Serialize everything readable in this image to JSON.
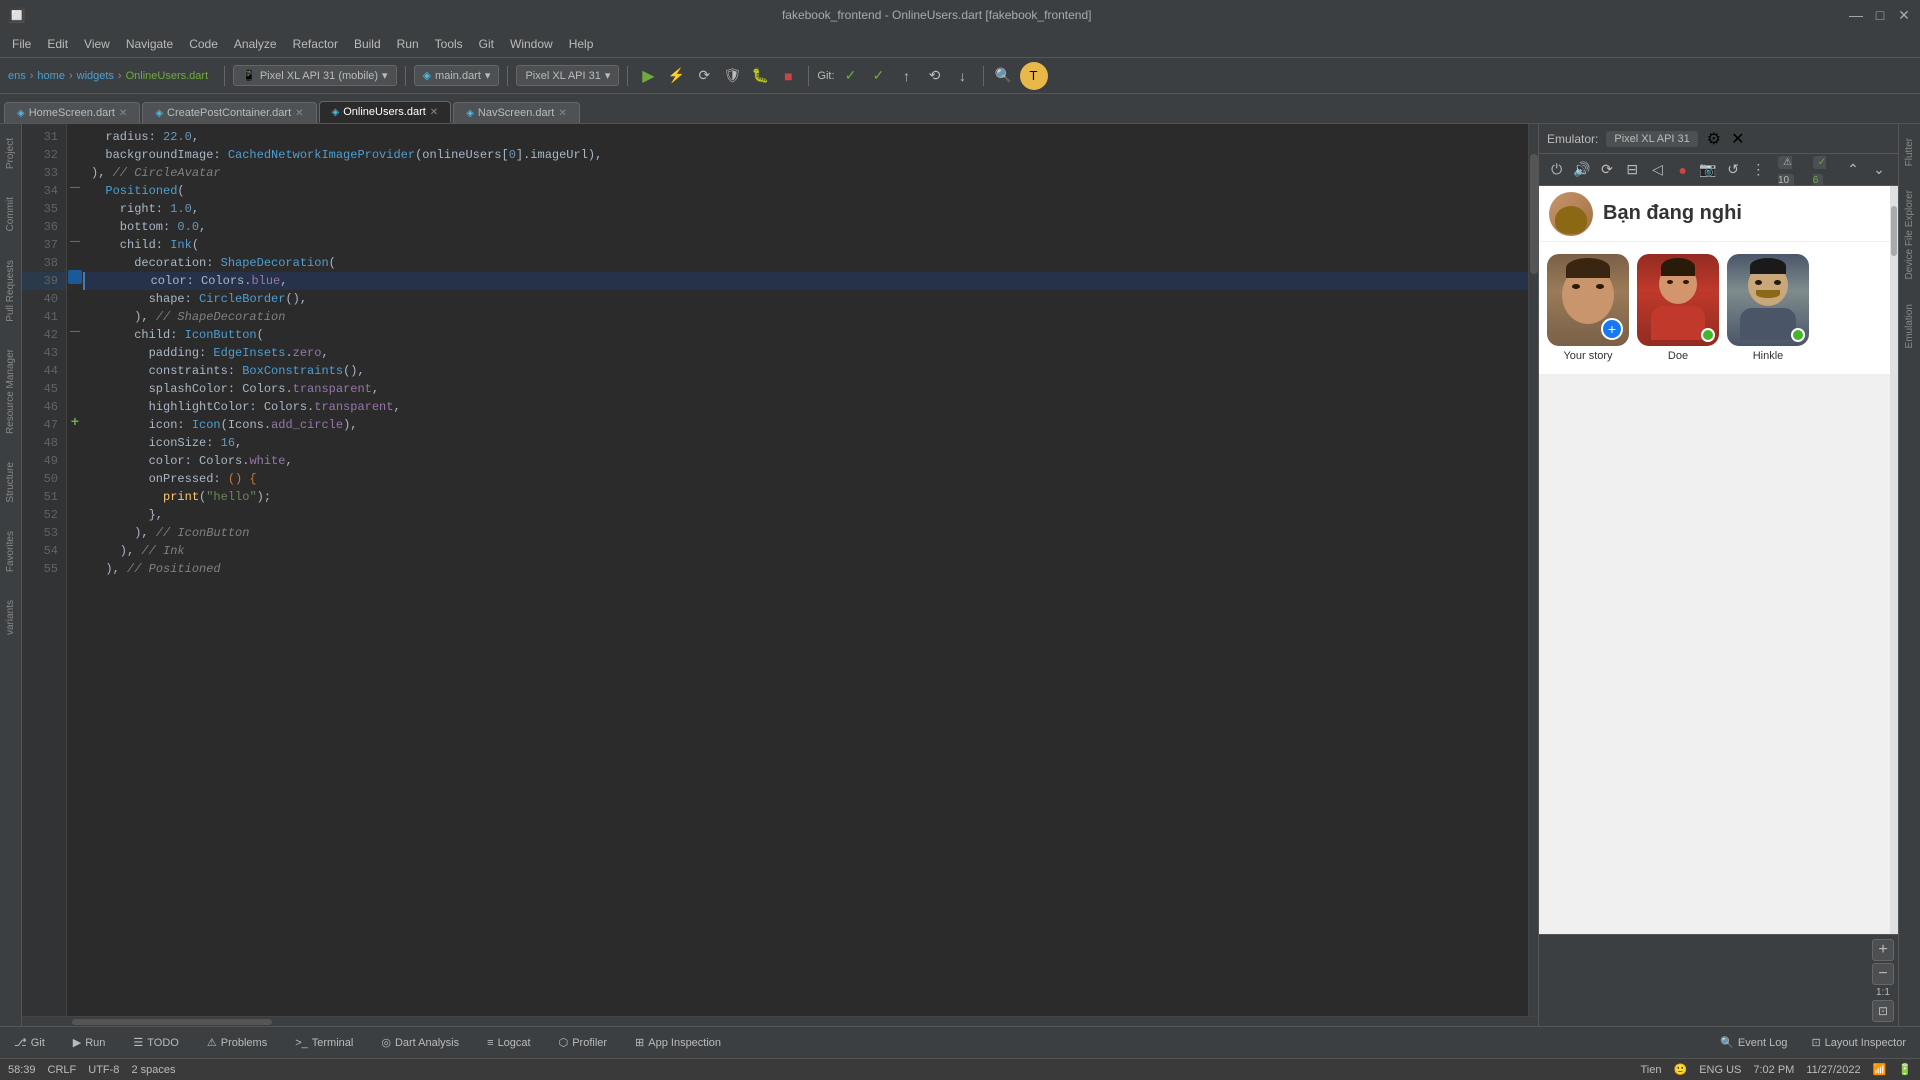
{
  "titleBar": {
    "title": "fakebook_frontend - OnlineUsers.dart [fakebook_frontend]",
    "minimize": "—",
    "maximize": "□",
    "close": "✕"
  },
  "menuBar": {
    "items": [
      "🔲",
      "File",
      "Edit",
      "View",
      "Navigate",
      "Code",
      "Analyze",
      "Refactor",
      "Build",
      "Run",
      "Tools",
      "Git",
      "Window",
      "Help"
    ]
  },
  "toolbar": {
    "breadcrumb": [
      "ens",
      "home",
      "widgets",
      "OnlineUsers.dart"
    ],
    "device": "Pixel XL API 31 (mobile)",
    "mainDart": "main.dart",
    "pixelXL": "Pixel XL API 31",
    "gitBadge": "Git:"
  },
  "tabs": [
    {
      "label": "HomeScreen.dart",
      "active": false
    },
    {
      "label": "CreatePostContainer.dart",
      "active": false
    },
    {
      "label": "OnlineUsers.dart",
      "active": true
    },
    {
      "label": "NavScreen.dart",
      "active": false
    }
  ],
  "code": {
    "lines": [
      {
        "num": 31,
        "content": "  radius: 22.0,",
        "tokens": [
          {
            "text": "  radius: ",
            "cls": ""
          },
          {
            "text": "22.0",
            "cls": "num"
          },
          {
            "text": ",",
            "cls": ""
          }
        ]
      },
      {
        "num": 32,
        "content": "  backgroundImage: CachedNetworkImageProvider(onlineUsers[0].imageUrl),",
        "tokens": [
          {
            "text": "  backgroundImage: ",
            "cls": ""
          },
          {
            "text": "CachedNetworkImageProvider",
            "cls": "blue-kw"
          },
          {
            "text": "(onlineUsers[",
            "cls": ""
          },
          {
            "text": "0",
            "cls": "num"
          },
          {
            "text": "].imageUrl),",
            "cls": ""
          }
        ]
      },
      {
        "num": 33,
        "content": "), // CircleAvatar",
        "tokens": [
          {
            "text": "), ",
            "cls": ""
          },
          {
            "text": "// CircleAvatar",
            "cls": "cmt"
          }
        ]
      },
      {
        "num": 34,
        "content": "  Positioned(",
        "tokens": [
          {
            "text": "  "
          },
          {
            "text": "Positioned",
            "cls": "blue-kw"
          },
          {
            "text": "(",
            "cls": ""
          }
        ],
        "hasArrow": true
      },
      {
        "num": 35,
        "content": "  right: 1.0,",
        "tokens": [
          {
            "text": "    right: ",
            "cls": ""
          },
          {
            "text": "1.0",
            "cls": "num"
          },
          {
            "text": ",",
            "cls": ""
          }
        ]
      },
      {
        "num": 36,
        "content": "  bottom: 0.0,",
        "tokens": [
          {
            "text": "    bottom: ",
            "cls": ""
          },
          {
            "text": "0.0",
            "cls": "num"
          },
          {
            "text": ",",
            "cls": ""
          }
        ]
      },
      {
        "num": 37,
        "content": "  child: Ink(",
        "tokens": [
          {
            "text": "    child: ",
            "cls": ""
          },
          {
            "text": "Ink",
            "cls": "blue-kw"
          },
          {
            "text": "(",
            "cls": ""
          }
        ],
        "hasArrow": true
      },
      {
        "num": 38,
        "content": "    decoration: ShapeDecoration(",
        "tokens": [
          {
            "text": "      decoration: ",
            "cls": ""
          },
          {
            "text": "ShapeDecoration",
            "cls": "blue-kw"
          },
          {
            "text": "(",
            "cls": ""
          }
        ]
      },
      {
        "num": 39,
        "content": "      color: Colors.blue,",
        "tokens": [
          {
            "text": "        color: ",
            "cls": ""
          },
          {
            "text": "Colors",
            "cls": "var"
          },
          {
            "text": ".",
            "cls": ""
          },
          {
            "text": "blue",
            "cls": "prop"
          },
          {
            "text": ",",
            "cls": ""
          }
        ],
        "highlighted": true,
        "hasMarker": true
      },
      {
        "num": 40,
        "content": "      shape: CircleBorder(),",
        "tokens": [
          {
            "text": "        shape: ",
            "cls": ""
          },
          {
            "text": "CircleBorder",
            "cls": "blue-kw"
          },
          {
            "text": "(),",
            "cls": ""
          }
        ]
      },
      {
        "num": 41,
        "content": "    ), // ShapeDecoration",
        "tokens": [
          {
            "text": "      ), ",
            "cls": ""
          },
          {
            "text": "// ShapeDecoration",
            "cls": "cmt"
          }
        ]
      },
      {
        "num": 42,
        "content": "    child: IconButton(",
        "tokens": [
          {
            "text": "      child: ",
            "cls": ""
          },
          {
            "text": "IconButton",
            "cls": "blue-kw"
          },
          {
            "text": "(",
            "cls": ""
          }
        ],
        "hasArrow": true
      },
      {
        "num": 43,
        "content": "      padding: EdgeInsets.zero,",
        "tokens": [
          {
            "text": "        padding: ",
            "cls": ""
          },
          {
            "text": "EdgeInsets",
            "cls": "blue-kw"
          },
          {
            "text": ".",
            "cls": ""
          },
          {
            "text": "zero",
            "cls": "prop"
          },
          {
            "text": ",",
            "cls": ""
          }
        ]
      },
      {
        "num": 44,
        "content": "      constraints: BoxConstraints(),",
        "tokens": [
          {
            "text": "        constraints: ",
            "cls": ""
          },
          {
            "text": "BoxConstraints",
            "cls": "blue-kw"
          },
          {
            "text": "(),",
            "cls": ""
          }
        ]
      },
      {
        "num": 45,
        "content": "      splashColor: Colors.transparent,",
        "tokens": [
          {
            "text": "        splashColor: ",
            "cls": ""
          },
          {
            "text": "Colors",
            "cls": "var"
          },
          {
            "text": ".",
            "cls": ""
          },
          {
            "text": "transparent",
            "cls": "prop"
          },
          {
            "text": ",",
            "cls": ""
          }
        ]
      },
      {
        "num": 46,
        "content": "      highlightColor: Colors.transparent,",
        "tokens": [
          {
            "text": "        highlightColor: ",
            "cls": ""
          },
          {
            "text": "Colors",
            "cls": "var"
          },
          {
            "text": ".",
            "cls": ""
          },
          {
            "text": "transparent",
            "cls": "prop"
          },
          {
            "text": ",",
            "cls": ""
          }
        ]
      },
      {
        "num": 47,
        "content": "    icon: Icon(Icons.add_circle),",
        "tokens": [
          {
            "text": "        icon: ",
            "cls": ""
          },
          {
            "text": "Icon",
            "cls": "blue-kw"
          },
          {
            "text": "(",
            "cls": ""
          },
          {
            "text": "Icons",
            "cls": "var"
          },
          {
            "text": ".",
            "cls": ""
          },
          {
            "text": "add_circle",
            "cls": "prop"
          },
          {
            "text": "),",
            "cls": ""
          }
        ],
        "hasArrow": true
      },
      {
        "num": 48,
        "content": "      iconSize: 16,",
        "tokens": [
          {
            "text": "        iconSize: ",
            "cls": ""
          },
          {
            "text": "16",
            "cls": "num"
          },
          {
            "text": ",",
            "cls": ""
          }
        ]
      },
      {
        "num": 49,
        "content": "      color: Colors.white,",
        "tokens": [
          {
            "text": "        color: ",
            "cls": ""
          },
          {
            "text": "Colors",
            "cls": "var"
          },
          {
            "text": ".",
            "cls": ""
          },
          {
            "text": "white",
            "cls": "prop"
          },
          {
            "text": ",",
            "cls": ""
          }
        ]
      },
      {
        "num": 50,
        "content": "      onPressed: () {",
        "tokens": [
          {
            "text": "        onPressed: ",
            "cls": ""
          },
          {
            "text": "() {",
            "cls": "kw"
          }
        ]
      },
      {
        "num": 51,
        "content": "        print(\"hello\");",
        "tokens": [
          {
            "text": "          ",
            "cls": ""
          },
          {
            "text": "print",
            "cls": "fn"
          },
          {
            "text": "(",
            "cls": ""
          },
          {
            "text": "\"hello\"",
            "cls": "str"
          },
          {
            "text": ");",
            "cls": ""
          }
        ]
      },
      {
        "num": 52,
        "content": "      },",
        "tokens": [
          {
            "text": "        },",
            "cls": ""
          }
        ]
      },
      {
        "num": 53,
        "content": "    ), // IconButton",
        "tokens": [
          {
            "text": "      ), ",
            "cls": ""
          },
          {
            "text": "// IconButton",
            "cls": "cmt"
          }
        ]
      },
      {
        "num": 54,
        "content": "  ), // Ink",
        "tokens": [
          {
            "text": "    ), ",
            "cls": ""
          },
          {
            "text": "// Ink",
            "cls": "cmt"
          }
        ]
      },
      {
        "num": 55,
        "content": "), // Positioned",
        "tokens": [
          {
            "text": "  ), ",
            "cls": ""
          },
          {
            "text": "// Positioned",
            "cls": "cmt"
          }
        ]
      }
    ]
  },
  "emulator": {
    "label": "Emulator:",
    "device": "Pixel XL API 31",
    "badge10": "⚠ 10",
    "badge6": "✓ 6",
    "phoneHeader": {
      "vietText": "Bạn đang nghi"
    },
    "stories": [
      {
        "label": "Your story",
        "type": "your_story"
      },
      {
        "label": "Doe",
        "type": "doe"
      },
      {
        "label": "Hinkle",
        "type": "hinkle"
      }
    ]
  },
  "bottomTabs": [
    {
      "icon": "⎇",
      "label": "Git"
    },
    {
      "icon": "▶",
      "label": "Run"
    },
    {
      "icon": "☰",
      "label": "TODO"
    },
    {
      "icon": "⚠",
      "label": "Problems"
    },
    {
      "icon": ">_",
      "label": "Terminal"
    },
    {
      "icon": "◎",
      "label": "Dart Analysis"
    },
    {
      "icon": "≡",
      "label": "Logcat"
    },
    {
      "icon": "⬡",
      "label": "Profiler"
    },
    {
      "icon": "⊞",
      "label": "App Inspection"
    }
  ],
  "statusBar": {
    "position": "58:39",
    "lineEnding": "CRLF",
    "encoding": "UTF-8",
    "indent": "2 spaces",
    "user": "Tien",
    "time": "7:02 PM",
    "date": "11/27/2022",
    "lang": "ENG US",
    "eventLog": "Event Log",
    "layoutInspector": "Layout Inspector"
  },
  "sideLabels": {
    "project": "Project",
    "commit": "Commit",
    "pullRequests": "Pull Requests",
    "resourceManager": "Resource Manager",
    "structure": "Structure",
    "favorites": "Favorites",
    "variants": "variants",
    "flutterPanel": "Flutter",
    "deviceFileExplorer": "Device File Explorer",
    "emulation": "Emulation"
  },
  "zoomControls": {
    "plus": "+",
    "minus": "−",
    "ratio11": "1:1",
    "fitBtn": "⊡"
  }
}
